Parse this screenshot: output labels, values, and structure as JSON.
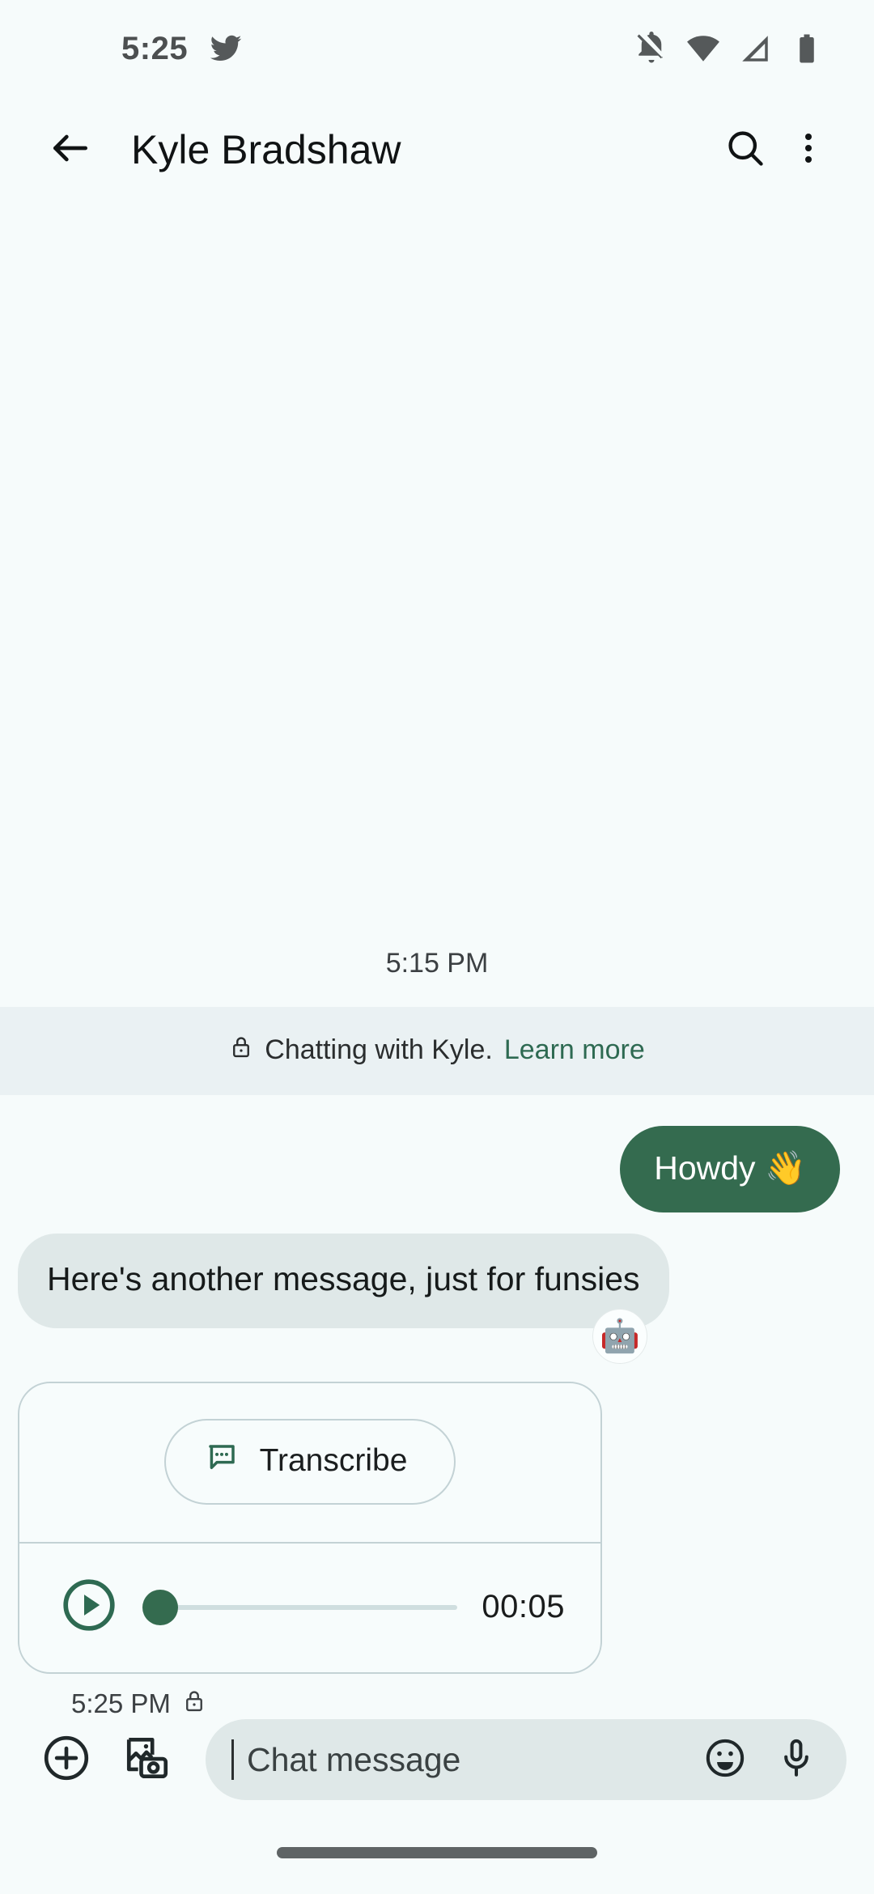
{
  "status_bar": {
    "time": "5:25",
    "left_icons": [
      "twitter-bird-icon"
    ],
    "right_icons": [
      "notifications-off-icon",
      "wifi-icon",
      "cellular-signal-icon",
      "battery-icon"
    ]
  },
  "app_bar": {
    "back_icon": "back-arrow-icon",
    "title": "Kyle Bradshaw",
    "search_icon": "search-icon",
    "overflow_icon": "more-vert-icon"
  },
  "conversation": {
    "day_divider": "5:15 PM",
    "encryption_banner": {
      "lock_icon": "lock-icon",
      "text": "Chatting with Kyle.",
      "link": "Learn more"
    },
    "messages": [
      {
        "direction": "outgoing",
        "text": "Howdy 👋"
      },
      {
        "direction": "incoming",
        "text": "Here's another message, just for funsies",
        "avatar": "🤖"
      },
      {
        "direction": "incoming",
        "type": "voice",
        "transcribe_label": "Transcribe",
        "transcribe_icon": "transcribe-speech-bubble-icon",
        "play_icon": "play-circle-icon",
        "duration": "00:05",
        "progress_percent": 0,
        "timestamp": "5:25 PM",
        "timestamp_lock_icon": "lock-icon"
      }
    ]
  },
  "input_bar": {
    "add_icon": "plus-circle-icon",
    "gallery_icon": "gallery-camera-icon",
    "placeholder": "Chat message",
    "value": "",
    "emoji_icon": "emoji-smiley-icon",
    "mic_icon": "microphone-icon"
  },
  "nav": {
    "home_indicator": "home-indicator"
  },
  "colors": {
    "page_background": "#F6FBFB",
    "outgoing_bubble": "#346B4F",
    "incoming_bubble": "#DFE8E8",
    "banner_background": "#EAF1F3",
    "accent_green": "#2E6A52",
    "card_border": "#C3D2D5"
  }
}
